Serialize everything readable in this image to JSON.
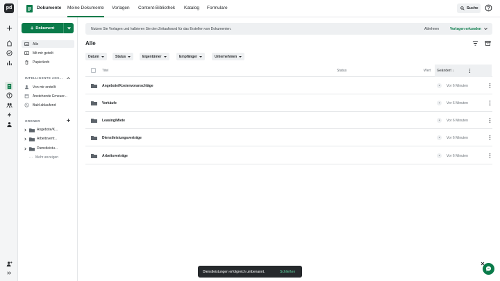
{
  "topnav": {
    "brand": "Dokumente",
    "tabs": [
      "Meine Dokumente",
      "Vorlagen",
      "Content-Bibliothek",
      "Katalog",
      "Formulare"
    ],
    "search_label": "Suche"
  },
  "sidebar": {
    "new_button": "Dokument",
    "nav": [
      "Alle",
      "Mit mir geteilt",
      "Papierkorb"
    ],
    "smart_header": "INTELLIGENTE ANS...",
    "smart_items": [
      "Von mir erstellt",
      "Anstehende Erneuer...",
      "Bald ablaufend"
    ],
    "folders_header": "ORDNER",
    "folders": [
      "Angebote/K...",
      "Arbeitsvertr...",
      "Dienstleistu..."
    ],
    "show_more": "Mehr anzeigen"
  },
  "banner": {
    "text": "Nutzen Sie Vorlagen und halbieren Sie den Zeitaufwand für das Erstellen von Dokumenten.",
    "dismiss": "Ablehnen",
    "explore": "Vorlagen erkunden"
  },
  "main": {
    "title": "Alle",
    "filters": [
      "Datum",
      "Status",
      "Eigentümer",
      "Empfänger",
      "Unternehmen"
    ],
    "columns": {
      "title": "Titel",
      "status": "Status",
      "value": "Wert",
      "changed": "Geändert ↓"
    },
    "rows": [
      {
        "name": "Angebote/Kostenvoranschläge",
        "changed": "Vor 6 Minuten"
      },
      {
        "name": "Verkäufe",
        "changed": "Vor 6 Minuten"
      },
      {
        "name": "Leasing/Miete",
        "changed": "Vor 6 Minuten"
      },
      {
        "name": "Dienstleistungsverträge",
        "changed": "Vor 6 Minuten"
      },
      {
        "name": "Arbeitsverträge",
        "changed": "Vor 6 Minuten"
      }
    ]
  },
  "toast": {
    "message": "Dienstleistungen erfolgreich umbenannt.",
    "undo": "Schließen"
  },
  "colors": {
    "accent": "#0a7b4a",
    "surface": "#eef0f2",
    "border": "#e4e6e8"
  }
}
